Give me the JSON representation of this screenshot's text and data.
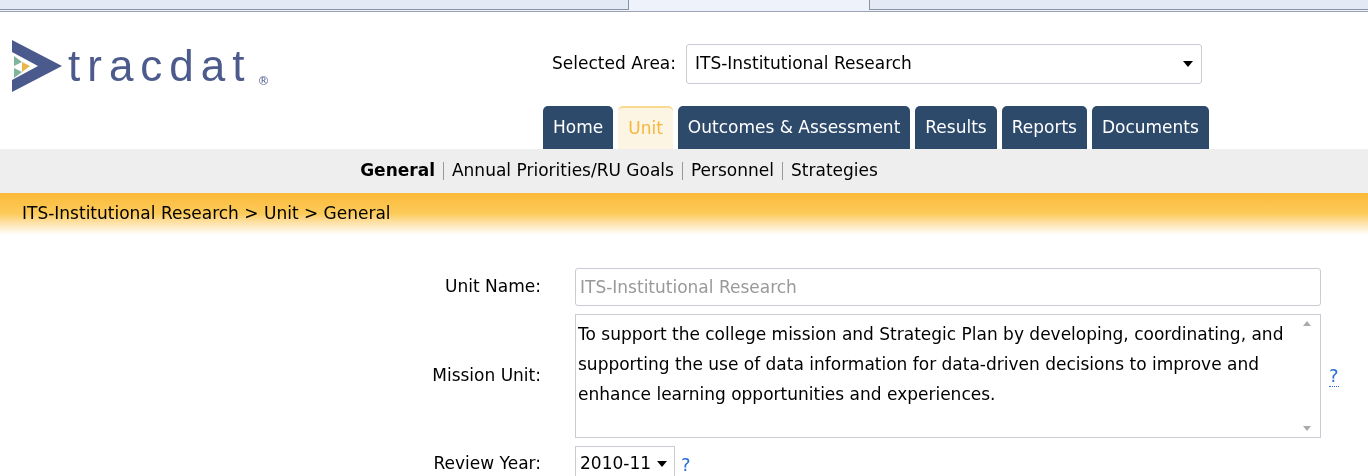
{
  "logo": {
    "text": "tracdat",
    "mark": "®"
  },
  "selected_area": {
    "label": "Selected Area:",
    "value": "ITS-Institutional Research"
  },
  "tabs": [
    {
      "label": "Home",
      "selected": false
    },
    {
      "label": "Unit",
      "selected": true
    },
    {
      "label": "Outcomes & Assessment",
      "selected": false
    },
    {
      "label": "Results",
      "selected": false
    },
    {
      "label": "Reports",
      "selected": false
    },
    {
      "label": "Documents",
      "selected": false
    }
  ],
  "subnav": [
    {
      "label": "General",
      "selected": true
    },
    {
      "label": "Annual Priorities/RU Goals",
      "selected": false
    },
    {
      "label": "Personnel",
      "selected": false
    },
    {
      "label": "Strategies",
      "selected": false
    }
  ],
  "breadcrumb": "ITS-Institutional Research > Unit > General",
  "form": [
    {
      "kind": "text",
      "label": "Unit Name:",
      "value": "ITS-Institutional Research",
      "disabled": true
    },
    {
      "kind": "textarea",
      "label": "Mission Unit:",
      "value": "To support the college mission and Strategic Plan by developing, coordinating, and supporting the use of data information for data-driven decisions to improve and enhance learning opportunities and experiences.",
      "help": "?"
    },
    {
      "kind": "select",
      "label": "Review Year:",
      "value": "2010-11",
      "help": "?"
    }
  ]
}
